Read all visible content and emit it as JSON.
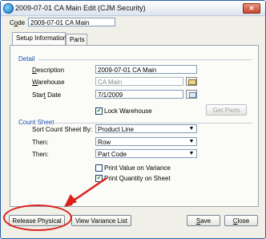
{
  "window": {
    "title": "2009-07-01 CA Main Edit (CJM Security)",
    "close_glyph": "✕"
  },
  "code": {
    "label": "Code",
    "value": "2009-07-01 CA Main"
  },
  "tabs": [
    {
      "label": "Setup Information",
      "active": true
    },
    {
      "label": "Parts",
      "active": false
    }
  ],
  "detail": {
    "title": "Detail",
    "description_label": "Description",
    "description_value": "2009-07-01 CA Main",
    "warehouse_label": "Warehouse",
    "warehouse_value": "CA Main",
    "start_date_label": "Start Date",
    "start_date_value": "7/1/2009",
    "lock_warehouse_label": "Lock Warehouse",
    "lock_warehouse_checked": true,
    "get_parts_label": "Get Parts"
  },
  "count_sheet": {
    "title": "Count Sheet",
    "sort_label": "Sort Count Sheet By:",
    "sort_value": "Product Line",
    "then1_label": "Then:",
    "then1_value": "Row",
    "then2_label": "Then:",
    "then2_value": "Part Code",
    "print_value_label": "Print Value on Variance",
    "print_value_checked": false,
    "print_qty_label": "Print Quantity on Sheet",
    "print_qty_checked": true
  },
  "buttons": {
    "release_physical": "Release Physical",
    "view_variance": "View Variance List",
    "save": "Save",
    "close": "Close"
  },
  "colors": {
    "annotation": "#d9221a",
    "group_title": "#1a4fb8"
  }
}
